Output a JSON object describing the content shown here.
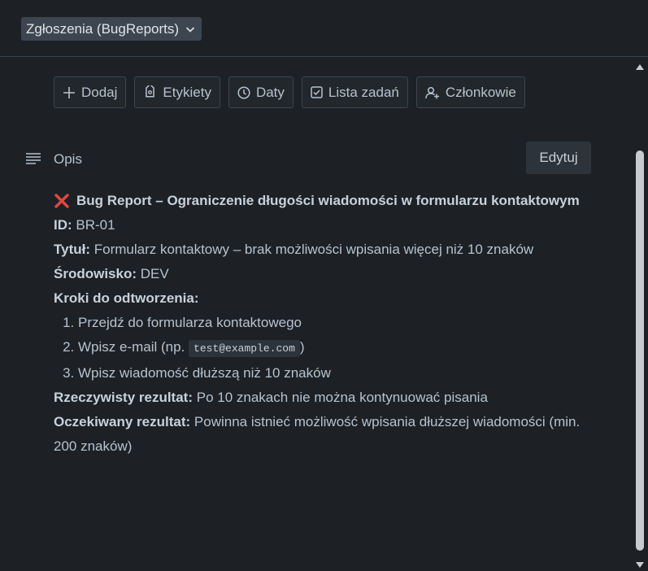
{
  "header": {
    "list_select_label": "Zgłoszenia (BugReports)"
  },
  "actions": [
    {
      "icon": "plus-icon",
      "label": "Dodaj"
    },
    {
      "icon": "tag-icon",
      "label": "Etykiety"
    },
    {
      "icon": "clock-icon",
      "label": "Daty"
    },
    {
      "icon": "checklist-icon",
      "label": "Lista zadań"
    },
    {
      "icon": "add-member-icon",
      "label": "Członkowie"
    }
  ],
  "description": {
    "title": "Opis",
    "edit_label": "Edytuj",
    "heading": "Bug Report – Ograniczenie długości wiadomości w formularzu kontaktowym",
    "heading_icon": "cross-mark-icon",
    "id_label": "ID:",
    "id_value": "BR-01",
    "title_label": "Tytuł:",
    "title_value": "Formularz kontaktowy – brak możliwości wpisania więcej niż 10 znaków",
    "env_label": "Środowisko:",
    "env_value": "DEV",
    "steps_label": "Kroki do odtworzenia:",
    "steps": {
      "s1": "Przejdź do formularza kontaktowego",
      "s2_before": "Wpisz e-mail (np.",
      "s2_code": "test@example.com",
      "s2_after": ")",
      "s3": "Wpisz wiadomość dłuższą niż 10 znaków"
    },
    "actual_label": "Rzeczywisty rezultat:",
    "actual_value": "Po 10 znakach nie można kontynuować pisania",
    "expected_label": "Oczekiwany rezultat:",
    "expected_value": "Powinna istnieć możliwość wpisania dłuższej wiadomości (min. 200 znaków)"
  },
  "colors": {
    "background": "#1d2125",
    "text": "#b6c2cf",
    "error_red": "#e2483d"
  }
}
